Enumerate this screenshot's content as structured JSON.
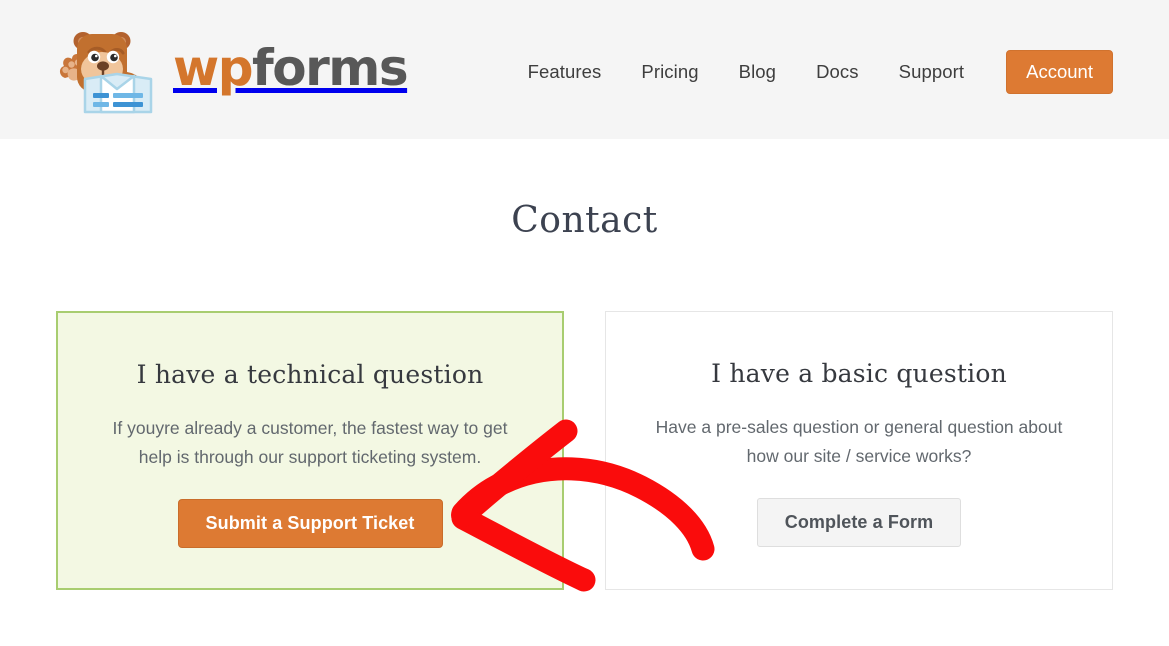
{
  "header": {
    "logo": {
      "icon": "wpforms-bear-mascot-icon",
      "text_primary": "wp",
      "text_secondary": "forms",
      "color_primary": "#d4762c",
      "color_secondary": "#585858"
    },
    "background_color": "#f5f5f5",
    "nav": [
      {
        "label": "Features"
      },
      {
        "label": "Pricing"
      },
      {
        "label": "Blog"
      },
      {
        "label": "Docs"
      },
      {
        "label": "Support"
      }
    ],
    "cta": {
      "label": "Account",
      "background_color": "#dd7a33",
      "text_color": "#ffffff"
    }
  },
  "main": {
    "page_title": "Contact",
    "cards": [
      {
        "id": "technical-question",
        "title": "I have a technical question",
        "body": "If youyre already a customer, the fastest way to get help is through our support ticketing system.",
        "button_label": "Submit a Support Ticket",
        "highlighted": true,
        "background_color": "#f3f8e3",
        "border_color": "#a8cd70",
        "button_background": "#dd7a33",
        "button_text_color": "#ffffff"
      },
      {
        "id": "basic-question",
        "title": "I have a basic question",
        "body": "Have a pre-sales question or general question about how our site / service works?",
        "button_label": "Complete a Form",
        "highlighted": false,
        "background_color": "#ffffff",
        "border_color": "#e6e6e6",
        "button_background": "#f4f4f4",
        "button_text_color": "#4f545a"
      }
    ]
  },
  "annotation": {
    "type": "hand-drawn-arrow",
    "color": "#fa0c0c",
    "points_to": "Submit a Support Ticket button",
    "direction": "left"
  }
}
